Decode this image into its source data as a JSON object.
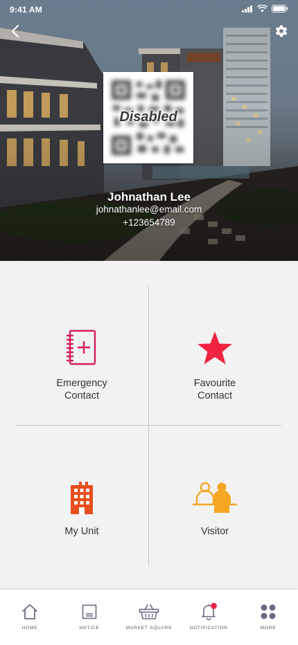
{
  "status_bar": {
    "time": "9:41 AM"
  },
  "header": {
    "back_icon": "chevron-left-icon",
    "settings_icon": "gear-icon"
  },
  "qr": {
    "overlay_text": "Disabled"
  },
  "profile": {
    "name": "Johnathan Lee",
    "email": "johnathanlee@email.com",
    "phone": "+123654789"
  },
  "tiles": [
    {
      "label_line1": "Emergency",
      "label_line2": "Contact",
      "icon": "contact-book-icon",
      "color": "#d81b60"
    },
    {
      "label_line1": "Favourite",
      "label_line2": "Contact",
      "icon": "star-icon",
      "color": "#f0243f"
    },
    {
      "label_line1": "My Unit",
      "icon": "building-icon",
      "color": "#e84e1c"
    },
    {
      "label_line1": "Visitor",
      "icon": "visitors-icon",
      "color": "#f5a623"
    }
  ],
  "tabbar": {
    "items": [
      {
        "label": "HOME",
        "icon": "home-icon"
      },
      {
        "label": "NOTICE",
        "icon": "notice-icon"
      },
      {
        "label": "MARKET SQUARE",
        "icon": "basket-icon"
      },
      {
        "label": "NOTIFICATION",
        "icon": "bell-icon"
      },
      {
        "label": "MORE",
        "icon": "more-grid-icon"
      }
    ],
    "icon_color": "#6b6a80",
    "badge_color": "#e8284a"
  }
}
